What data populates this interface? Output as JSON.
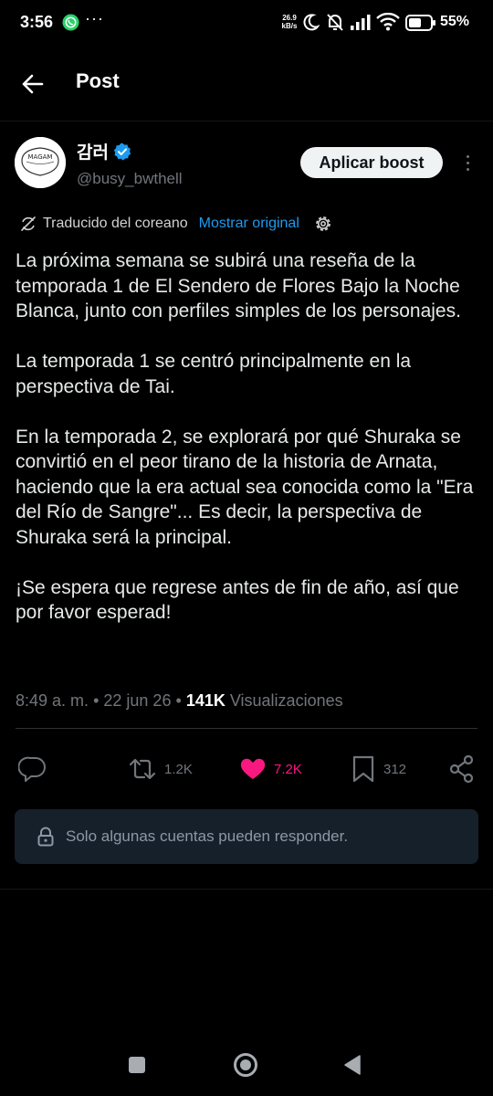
{
  "status_bar": {
    "time": "3:56",
    "dots": "···",
    "net_speed_value": "26.9",
    "net_speed_unit": "kB/s",
    "battery": "55%"
  },
  "header": {
    "title": "Post"
  },
  "author": {
    "display_name": "감러",
    "handle": "@busy_bwthell",
    "avatar_text": "MAGAM",
    "verified": true
  },
  "boost_button": "Aplicar boost",
  "translation": {
    "label": "Traducido del coreano",
    "show_original": "Mostrar original"
  },
  "post": {
    "paragraphs": [
      "La próxima semana se subirá una reseña de la temporada 1 de El Sendero de Flores Bajo la Noche Blanca, junto con perfiles simples de los personajes.",
      "La temporada 1 se centró principalmente en la perspectiva de Tai.",
      "En la temporada 2, se explorará por qué Shuraka se convirtió en el peor tirano de la historia de Arnata, haciendo que la era actual sea conocida como la \"Era del Río de Sangre\"... Es decir, la perspectiva de Shuraka será la principal.",
      "¡Se espera que regrese antes de fin de año, así que por favor esperad!"
    ]
  },
  "meta": {
    "time": "8:49 a. m.",
    "separator": "•",
    "date": "22 jun 26",
    "views_count": "141K",
    "views_label": "Visualizaciones"
  },
  "actions": {
    "reposts": "1.2K",
    "likes": "7.2K",
    "bookmarks": "312"
  },
  "reply_restriction": "Solo algunas cuentas pueden responder.",
  "colors": {
    "background": "#000000",
    "accent": "#1d9bf0",
    "like": "#f91880",
    "muted": "#71767b",
    "restriction_bg": "#16202a"
  }
}
